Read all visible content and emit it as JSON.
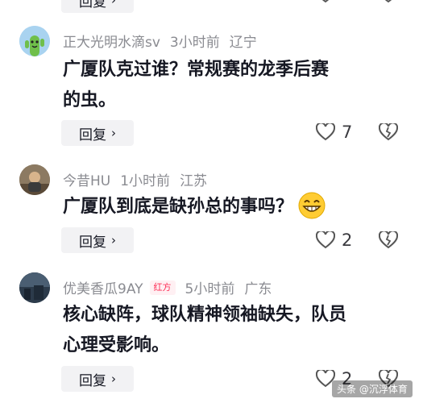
{
  "top_partial": {
    "reply_label": "回复"
  },
  "comments": [
    {
      "username": "正大光明水滴sv",
      "time": "3小时前",
      "location": "辽宁",
      "text_line1": "广厦队克过谁？常规赛的龙季后赛",
      "text_line2": "的虫。",
      "reply_label": "回复",
      "likes": "7",
      "avatar_icon": "cactus-avatar"
    },
    {
      "username": "今昔HU",
      "time": "1小时前",
      "location": "江苏",
      "text_line1": "广厦队到底是缺孙总的事吗？",
      "reply_label": "回复",
      "likes": "2",
      "emoji": "grinning-face-emoji",
      "avatar_icon": "photo-avatar"
    },
    {
      "username": "优美香瓜9AY",
      "badge": "红方",
      "time": "5小时前",
      "location": "广东",
      "text_line1": "核心缺阵，球队精神领袖缺失，队员",
      "text_line2": "心理受影响。",
      "reply_label": "回复",
      "likes": "2",
      "avatar_icon": "photo-avatar"
    }
  ],
  "watermark": "头条 @沉浮体育"
}
